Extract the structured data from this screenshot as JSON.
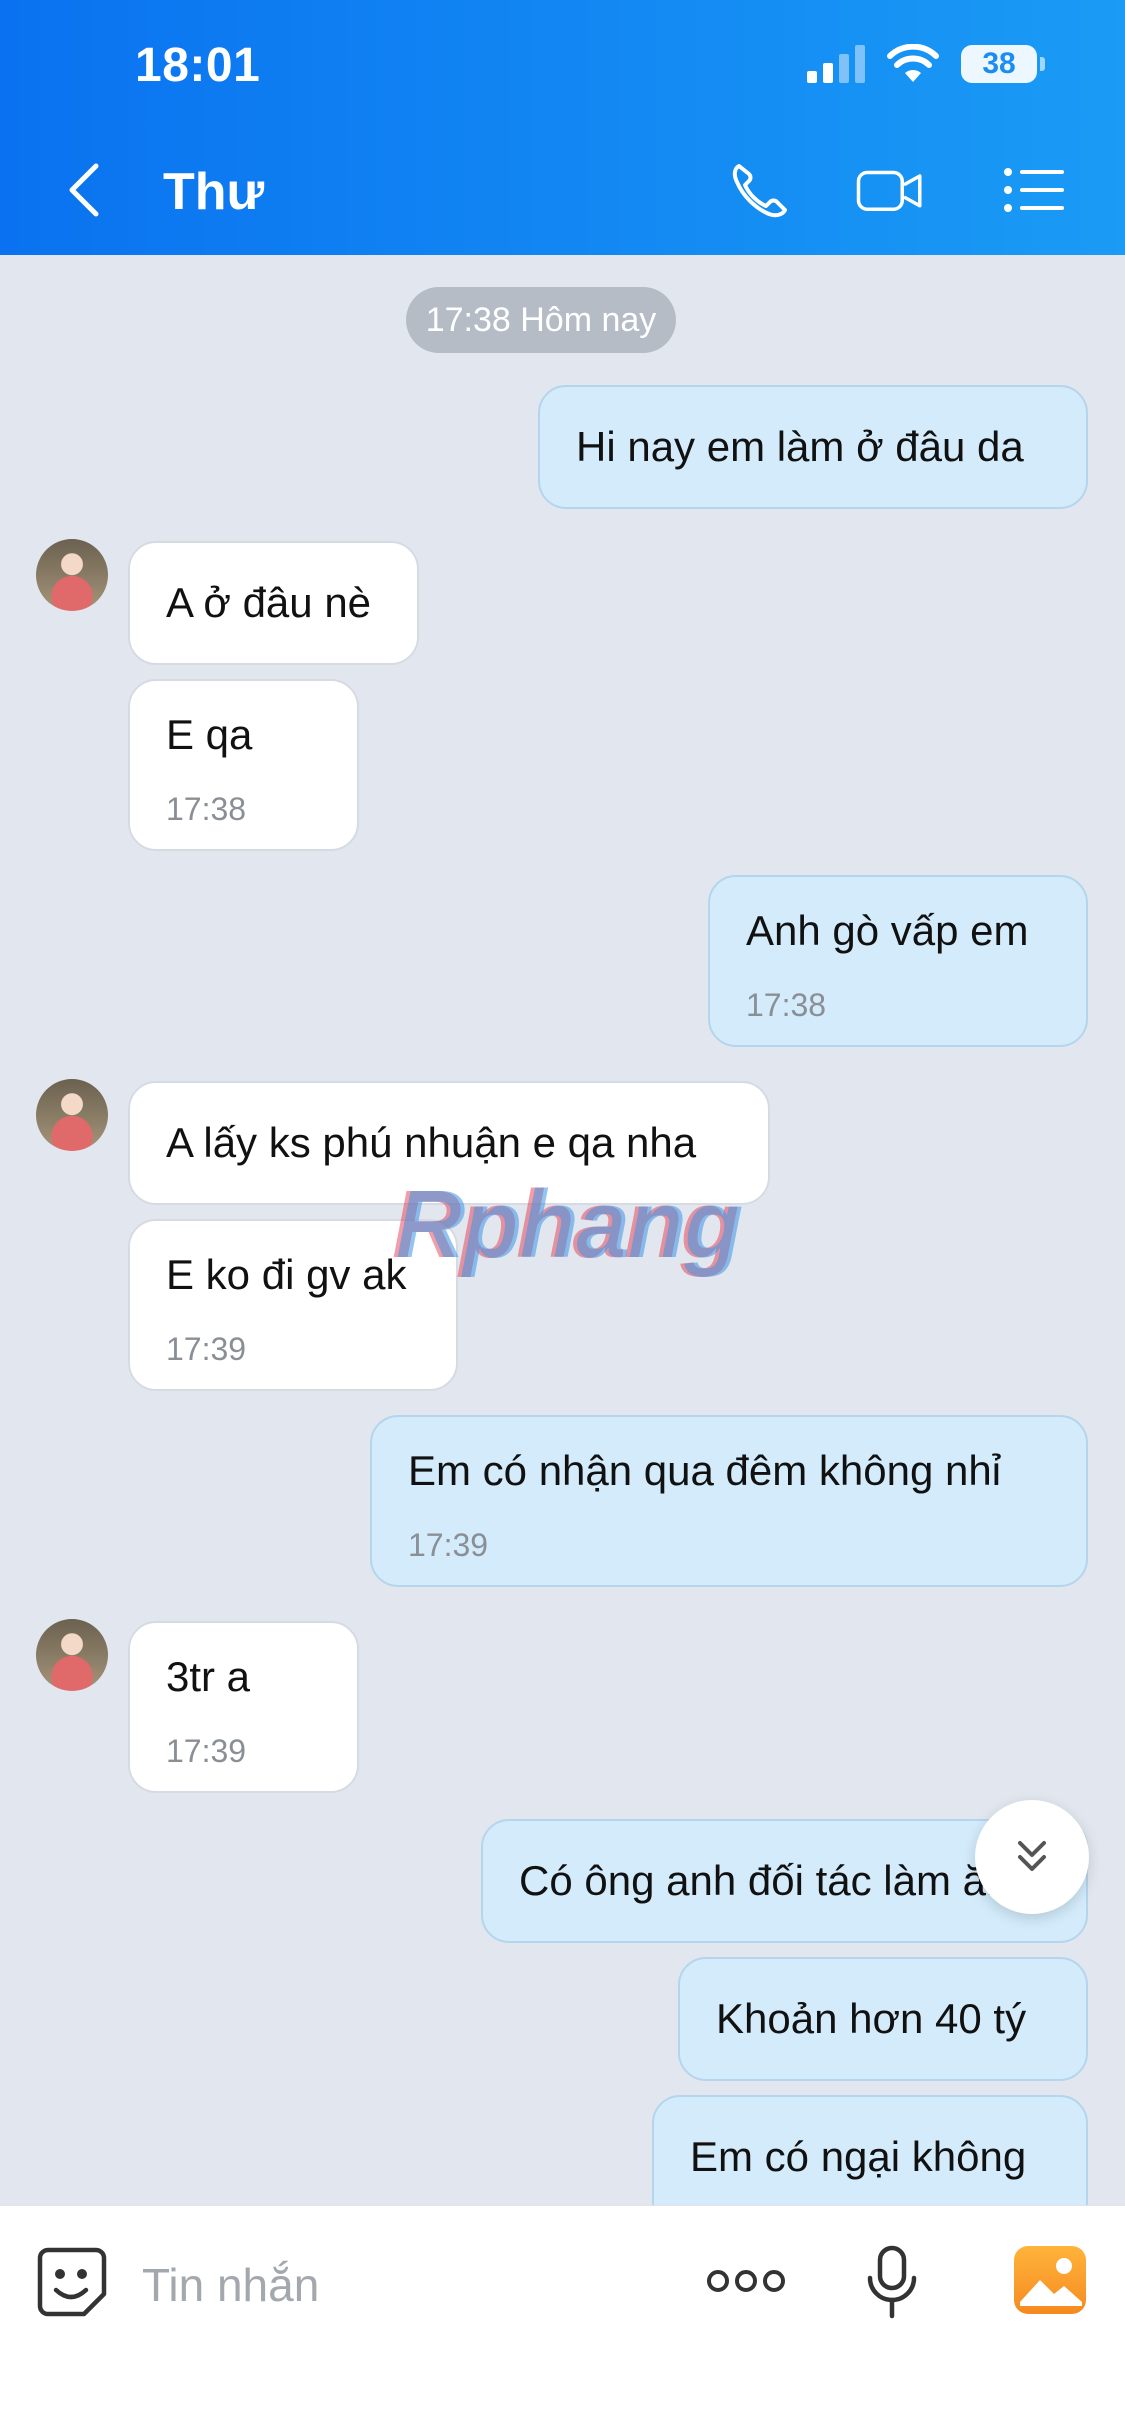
{
  "status_bar": {
    "time": "18:01",
    "battery": "38"
  },
  "header": {
    "title": "Thư"
  },
  "chat": {
    "date_separator": "17:38 Hôm nay",
    "messages": [
      {
        "dir": "out",
        "text": "Hi nay em làm ở đâu da",
        "time": ""
      },
      {
        "dir": "in",
        "text": "A ở đâu nè",
        "time": ""
      },
      {
        "dir": "in",
        "text": "E qa",
        "time": "17:38"
      },
      {
        "dir": "out",
        "text": "Anh gò vấp em",
        "time": "17:38"
      },
      {
        "dir": "in",
        "text": "A lấy ks phú nhuận e qa nha",
        "time": ""
      },
      {
        "dir": "in",
        "text": "E ko đi gv ak",
        "time": "17:39"
      },
      {
        "dir": "out",
        "text": "Em có nhận qua đêm không nhỉ",
        "time": "17:39"
      },
      {
        "dir": "in",
        "text": "3tr a",
        "time": "17:39"
      },
      {
        "dir": "out",
        "text": "Có ông anh đối tác làm ăn",
        "time": ""
      },
      {
        "dir": "out",
        "text": "Khoản hơn 40 tý",
        "time": ""
      },
      {
        "dir": "out",
        "text": "Em có ngại không",
        "time": ""
      }
    ]
  },
  "watermark": "Rphang",
  "input_bar": {
    "placeholder": "Tin nhắn"
  },
  "colors": {
    "header_start": "#0a72f0",
    "header_end": "#1a9bf5",
    "outgoing_bubble": "#d3ebfb",
    "incoming_bubble": "#ffffff"
  },
  "icons": [
    "back-icon",
    "phone-icon",
    "video-call-icon",
    "list-menu-icon",
    "scroll-down-icon",
    "sticker-icon",
    "more-icon",
    "microphone-icon",
    "image-icon"
  ]
}
